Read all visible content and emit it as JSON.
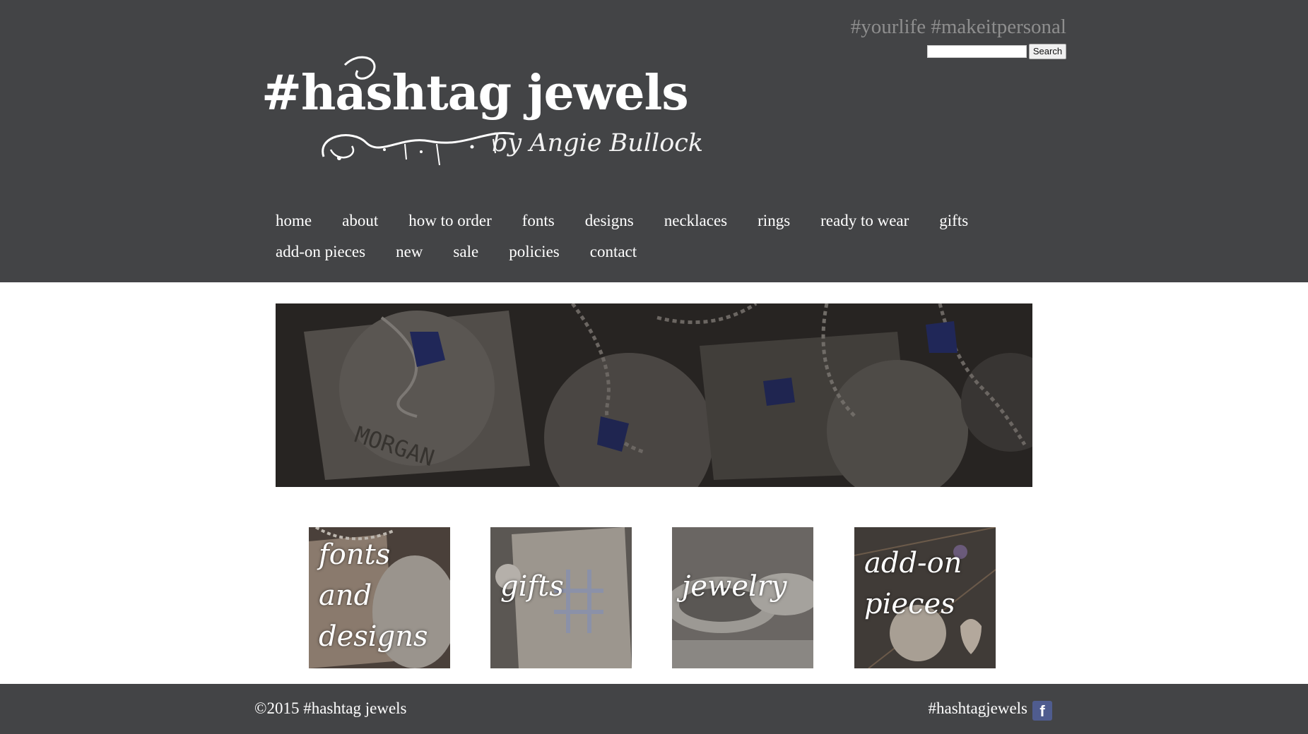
{
  "header": {
    "tagline": "#yourlife #makeitpersonal",
    "search": {
      "value": "",
      "button": "Search"
    },
    "logo": {
      "title": "#hashtag jewels",
      "subtitle": "by Angie Bullock"
    }
  },
  "nav": {
    "row1": [
      "home",
      "about",
      "how to order",
      "fonts",
      "designs",
      "necklaces",
      "rings",
      "ready to wear",
      "gifts"
    ],
    "row2": [
      "add-on pieces",
      "new",
      "sale",
      "policies",
      "contact"
    ]
  },
  "tiles": [
    {
      "label": "fonts\nand\ndesigns"
    },
    {
      "label": "gifts"
    },
    {
      "label": "jewelry"
    },
    {
      "label": "add-on\npieces"
    }
  ],
  "footer": {
    "copyright": "©2015 #hashtag jewels",
    "social_label": "#hashtagjewels",
    "facebook_glyph": "f"
  },
  "colors": {
    "header_bg": "#434446",
    "tagline": "#8e8e8e",
    "facebook": "#4f5c8f"
  },
  "icons": {
    "facebook": "facebook-icon"
  }
}
